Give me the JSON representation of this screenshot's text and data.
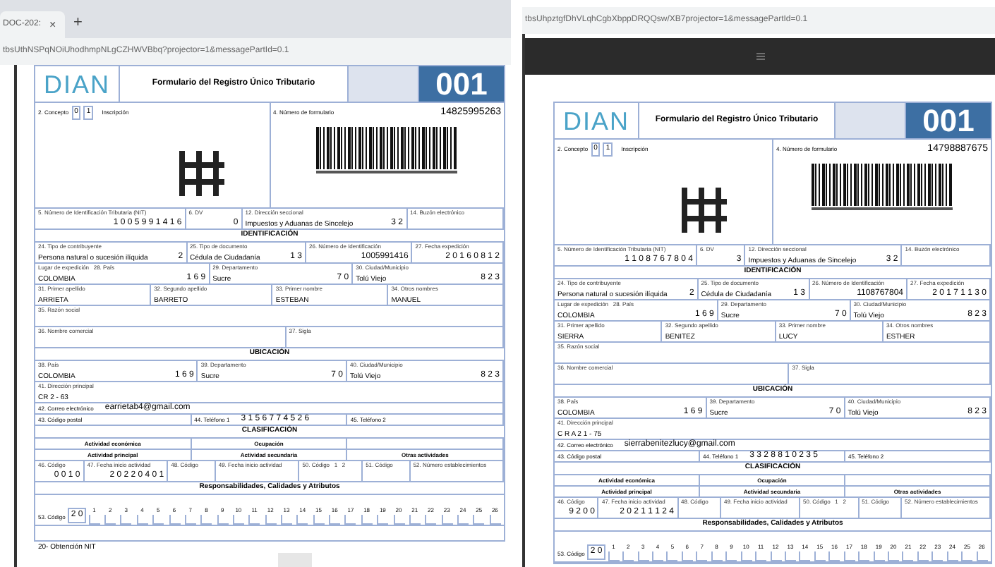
{
  "windows": [
    {
      "kind": "tabbed",
      "tab": {
        "title": "DOC-202:",
        "close": "×",
        "selected": true
      },
      "new_tab": "+",
      "url": "tbsUthNSPqNOiUhodhmpNLgCZHWVBbq?projector=1&messagePartId=0.1",
      "form": {
        "logo": "DIAN",
        "title": "Formulario del Registro Único Tributario",
        "code": "001",
        "concept": {
          "label": "2. Concepto",
          "digits": [
            "0",
            "1"
          ],
          "text": "Inscripción"
        },
        "form_number": {
          "label": "4. Número de formulario",
          "value": "14825995263"
        },
        "rows": [
          {
            "kind": "cells",
            "cells": [
              {
                "label": "5. Número de Identificación Tributaria (NIT)",
                "value": "1 0 0 5 9 9 1 4 1 6"
              },
              {
                "label": "6. DV",
                "value": "0"
              },
              {
                "label": "12. Dirección seccional",
                "note": "Impuestos y Aduanas de Sincelejo",
                "value": "3 2"
              },
              {
                "label": "14. Buzón electrónico"
              }
            ]
          },
          {
            "kind": "heading",
            "text": "IDENTIFICACIÓN"
          },
          {
            "kind": "cells",
            "cells": [
              {
                "label": "24. Tipo de contribuyente",
                "note": "Persona natural o sucesión ilíquida",
                "value": "2"
              },
              {
                "label": "25. Tipo de documento",
                "note": "Cédula de Ciudadanía",
                "value": "1 3"
              },
              {
                "label": "26. Número de Identificación",
                "value": "1005991416"
              },
              {
                "label": "27. Fecha expedición",
                "value": "2 0 1 6 0 8 1 2"
              }
            ]
          },
          {
            "kind": "cells",
            "cells": [
              {
                "label": "Lugar de expedición   28. País",
                "note": "COLOMBIA",
                "value": "1 6 9"
              },
              {
                "label": "29. Departamento",
                "note": "Sucre",
                "value": "7 0"
              },
              {
                "label": "30. Ciudad/Municipio",
                "note": "Tolú Viejo",
                "value": "8 2 3"
              }
            ]
          },
          {
            "kind": "cells",
            "cells": [
              {
                "label": "31. Primer apellido",
                "note": "ARRIETA"
              },
              {
                "label": "32. Segundo apellido",
                "note": "BARRETO"
              },
              {
                "label": "33. Primer nombre",
                "note": "ESTEBAN"
              },
              {
                "label": "34. Otros nombres",
                "note": "MANUEL"
              }
            ]
          },
          {
            "kind": "cells",
            "cells": [
              {
                "label": "35. Razón social"
              }
            ]
          },
          {
            "kind": "cells",
            "cells": [
              {
                "label": "36. Nombre comercial"
              },
              {
                "label": "37. Sigla"
              }
            ]
          },
          {
            "kind": "heading",
            "text": "UBICACIÓN"
          },
          {
            "kind": "cells",
            "cells": [
              {
                "label": "38. País",
                "note": "COLOMBIA",
                "value": "1 6 9"
              },
              {
                "label": "39. Departamento",
                "note": "Sucre",
                "value": "7 0"
              },
              {
                "label": "40. Ciudad/Municipio",
                "note": "Tolú Viejo",
                "value": "8 2 3"
              }
            ]
          },
          {
            "kind": "cells",
            "cells": [
              {
                "label": "41. Dirección principal",
                "note": "CR 2 - 63"
              }
            ]
          },
          {
            "kind": "inline",
            "cells": [
              {
                "label": "42. Correo electrónico",
                "value": "earrietab4@gmail.com"
              }
            ]
          },
          {
            "kind": "inline",
            "cells": [
              {
                "label": "43. Código postal"
              },
              {
                "label": "44. Teléfono 1",
                "value": "3 1 5 6 7 7 4 5 2 6"
              },
              {
                "label": "45. Teléfono 2"
              }
            ]
          },
          {
            "kind": "heading",
            "text": "CLASIFICACIÓN"
          },
          {
            "kind": "subheading",
            "cells": [
              "Actividad económica",
              "Ocupación",
              ""
            ]
          },
          {
            "kind": "subheading",
            "cells": [
              "Actividad principal",
              "Actividad secundaria",
              "Otras actividades"
            ]
          },
          {
            "kind": "cells",
            "cells": [
              {
                "label": "46. Código",
                "value": "0 0 1 0"
              },
              {
                "label": "47. Fecha inicio actividad",
                "value": "2 0 2 2 0 4 0 1"
              },
              {
                "label": "48. Código"
              },
              {
                "label": "49. Fecha inicio actividad"
              },
              {
                "label": "50. Código   1   2"
              },
              {
                "label": "51. Código"
              },
              {
                "label": "52. Número establecimientos"
              }
            ]
          },
          {
            "kind": "heading",
            "text": "Responsabilidades, Calidades y Atributos"
          },
          {
            "kind": "boxes",
            "label": "53. Código",
            "value": "2 0",
            "numbers": [
              "1",
              "2",
              "3",
              "4",
              "5",
              "6",
              "7",
              "8",
              "9",
              "10",
              "11",
              "12",
              "13",
              "14",
              "15",
              "16",
              "17",
              "18",
              "19",
              "20",
              "21",
              "22",
              "23",
              "24",
              "25",
              "26"
            ]
          },
          {
            "kind": "note",
            "text": "20- Obtención NIT"
          }
        ]
      }
    },
    {
      "kind": "viewer",
      "url": "tbsUhpztgfDhVLqhCgbXbppDRQQsw/XB7projector=1&messagePartId=0.1",
      "form": {
        "logo": "DIAN",
        "title": "Formulario del Registro Único Tributario",
        "code": "001",
        "concept": {
          "label": "2. Concepto",
          "digits": [
            "0",
            "1"
          ],
          "text": "Inscripción"
        },
        "form_number": {
          "label": "4. Número de formulario",
          "value": "14798887675"
        },
        "rows": [
          {
            "kind": "cells",
            "cells": [
              {
                "label": "5. Número de Identificación Tributaria (NIT)",
                "value": "1 1 0 8 7 6 7 8 0 4"
              },
              {
                "label": "6. DV",
                "value": "3"
              },
              {
                "label": "12. Dirección seccional",
                "note": "Impuestos y Aduanas de Sincelejo",
                "value": "3 2"
              },
              {
                "label": "14. Buzón electrónico"
              }
            ]
          },
          {
            "kind": "heading",
            "text": "IDENTIFICACIÓN"
          },
          {
            "kind": "cells",
            "cells": [
              {
                "label": "24. Tipo de contribuyente",
                "note": "Persona natural o sucesión ilíquida",
                "value": "2"
              },
              {
                "label": "25. Tipo de documento",
                "note": "Cédula de Ciudadanía",
                "value": "1 3"
              },
              {
                "label": "26. Número de Identificación",
                "value": "1108767804"
              },
              {
                "label": "27. Fecha expedición",
                "value": "2 0 1 7 1 1 3 0"
              }
            ]
          },
          {
            "kind": "cells",
            "cells": [
              {
                "label": "Lugar de expedición   28. País",
                "note": "COLOMBIA",
                "value": "1 6 9"
              },
              {
                "label": "29. Departamento",
                "note": "Sucre",
                "value": "7 0"
              },
              {
                "label": "30. Ciudad/Municipio",
                "note": "Tolú Viejo",
                "value": "8 2 3"
              }
            ]
          },
          {
            "kind": "cells",
            "cells": [
              {
                "label": "31. Primer apellido",
                "note": "SIERRA"
              },
              {
                "label": "32. Segundo apellido",
                "note": "BENITEZ"
              },
              {
                "label": "33. Primer nombre",
                "note": "LUCY"
              },
              {
                "label": "34. Otros nombres",
                "note": "ESTHER"
              }
            ]
          },
          {
            "kind": "cells",
            "cells": [
              {
                "label": "35. Razón social"
              }
            ]
          },
          {
            "kind": "cells",
            "cells": [
              {
                "label": "36. Nombre comercial"
              },
              {
                "label": "37. Sigla"
              }
            ]
          },
          {
            "kind": "heading",
            "text": "UBICACIÓN"
          },
          {
            "kind": "cells",
            "cells": [
              {
                "label": "38. País",
                "note": "COLOMBIA",
                "value": "1 6 9"
              },
              {
                "label": "39. Departamento",
                "note": "Sucre",
                "value": "7 0"
              },
              {
                "label": "40. Ciudad/Municipio",
                "note": "Tolú Viejo",
                "value": "8 2 3"
              }
            ]
          },
          {
            "kind": "cells",
            "cells": [
              {
                "label": "41. Dirección principal",
                "note": "C R A 2 1 - 75"
              }
            ]
          },
          {
            "kind": "inline",
            "cells": [
              {
                "label": "42. Correo electrónico",
                "value": "sierrabenitezlucy@gmail.com"
              }
            ]
          },
          {
            "kind": "inline",
            "cells": [
              {
                "label": "43. Código postal"
              },
              {
                "label": "44. Teléfono 1",
                "value": "3 3 2 8 8 1 0 2 3 5"
              },
              {
                "label": "45. Teléfono 2"
              }
            ]
          },
          {
            "kind": "heading",
            "text": "CLASIFICACIÓN"
          },
          {
            "kind": "subheading",
            "cells": [
              "Actividad económica",
              "Ocupación",
              ""
            ]
          },
          {
            "kind": "subheading",
            "cells": [
              "Actividad principal",
              "Actividad secundaria",
              "Otras actividades"
            ]
          },
          {
            "kind": "cells",
            "cells": [
              {
                "label": "46. Código",
                "value": "9 2 0 0"
              },
              {
                "label": "47. Fecha inicio actividad",
                "value": "2 0 2 1 1 1 2 4"
              },
              {
                "label": "48. Código"
              },
              {
                "label": "49. Fecha inicio actividad"
              },
              {
                "label": "50. Código   1   2"
              },
              {
                "label": "51. Código"
              },
              {
                "label": "52. Número establecimientos"
              }
            ]
          },
          {
            "kind": "heading",
            "text": "Responsabilidades, Calidades y Atributos"
          },
          {
            "kind": "boxes",
            "label": "53. Código",
            "value": "2 0",
            "numbers": [
              "1",
              "2",
              "3",
              "4",
              "5",
              "6",
              "7",
              "8",
              "9",
              "10",
              "11",
              "12",
              "13",
              "14",
              "15",
              "16",
              "17",
              "18",
              "19",
              "20",
              "21",
              "22",
              "23",
              "24",
              "25",
              "26"
            ]
          }
        ]
      }
    }
  ]
}
